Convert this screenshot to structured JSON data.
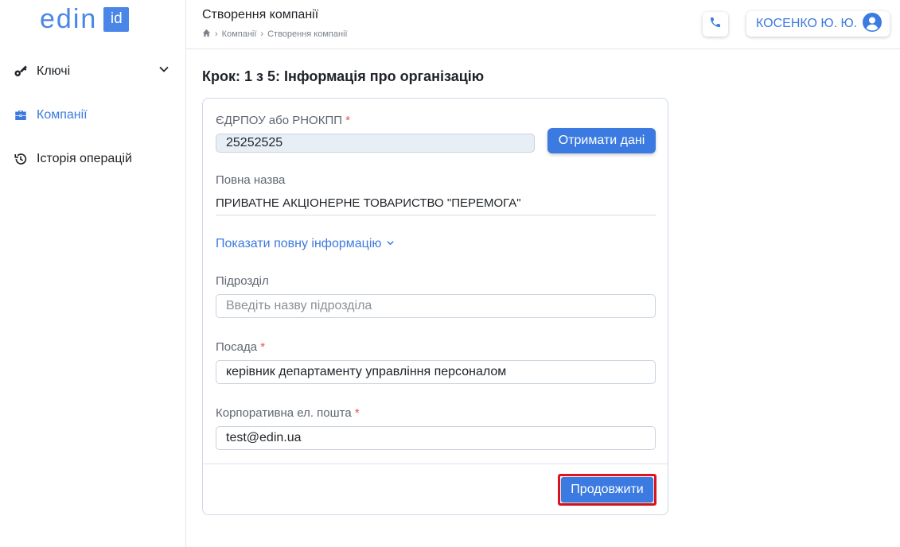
{
  "brand": {
    "word": "edin",
    "badge": "id"
  },
  "sidebar": {
    "items": [
      {
        "label": "Ключі",
        "icon": "key-icon",
        "active": false,
        "expandable": true
      },
      {
        "label": "Компанії",
        "icon": "briefcase-icon",
        "active": true,
        "expandable": false
      },
      {
        "label": "Історія операцій",
        "icon": "history-icon",
        "active": false,
        "expandable": false
      }
    ]
  },
  "header": {
    "title": "Створення компанії",
    "breadcrumb": [
      "Компанії",
      "Створення компанії"
    ],
    "user": "КОСЕНКО Ю. Ю."
  },
  "form": {
    "step_title": "Крок: 1 з 5: Інформація про організацію",
    "edrpou": {
      "label": "ЄДРПОУ або РНОКПП",
      "required_mark": "*",
      "value": "25252525"
    },
    "fetch_button": "Отримати дані",
    "full_name": {
      "label": "Повна назва",
      "value": "ПРИВАТНЕ АКЦІОНЕРНЕ ТОВАРИСТВО \"ПЕРЕМОГА\""
    },
    "show_more": "Показати повну інформацію",
    "division": {
      "label": "Підрозділ",
      "placeholder": "Введіть назву підрозділа"
    },
    "position": {
      "label": "Посада",
      "required_mark": "*",
      "value": "керівник департаменту управління персоналом"
    },
    "email": {
      "label": "Корпоративна ел. пошта",
      "required_mark": "*",
      "value": "test@edin.ua"
    },
    "continue_button": "Продовжити"
  },
  "colors": {
    "accent": "#3b7ae0",
    "required": "#e5534b",
    "highlight": "#e0141f"
  }
}
